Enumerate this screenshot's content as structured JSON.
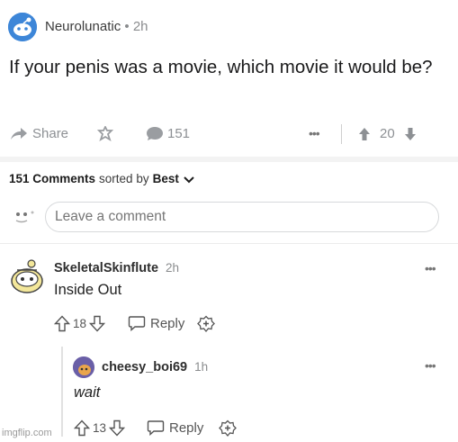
{
  "post": {
    "author": "Neurolunatic",
    "age": "2h",
    "title": "If your penis was a movie, which movie it would be?",
    "share_label": "Share",
    "comment_count": "151",
    "score": "20"
  },
  "comments_header": {
    "count_label": "151 Comments",
    "sorted_by": "sorted by",
    "sort_value": "Best"
  },
  "comment_input": {
    "placeholder": "Leave a comment"
  },
  "comments": [
    {
      "author": "SkeletalSkinflute",
      "age": "2h",
      "body": "Inside Out",
      "score": "18",
      "reply_label": "Reply"
    },
    {
      "author": "cheesy_boi69",
      "age": "1h",
      "body": "wait",
      "score": "13",
      "reply_label": "Reply"
    }
  ],
  "watermark": "imgflip.com",
  "colors": {
    "accent": "#3d86d8",
    "muted": "#8a8c8e"
  },
  "icons": [
    "snoo-avatar-icon",
    "share-arrow-icon",
    "award-icon",
    "comment-bubble-icon",
    "more-dots-icon",
    "upvote-icon",
    "downvote-icon",
    "chevron-down-icon",
    "reply-bubble-icon",
    "add-award-icon"
  ]
}
